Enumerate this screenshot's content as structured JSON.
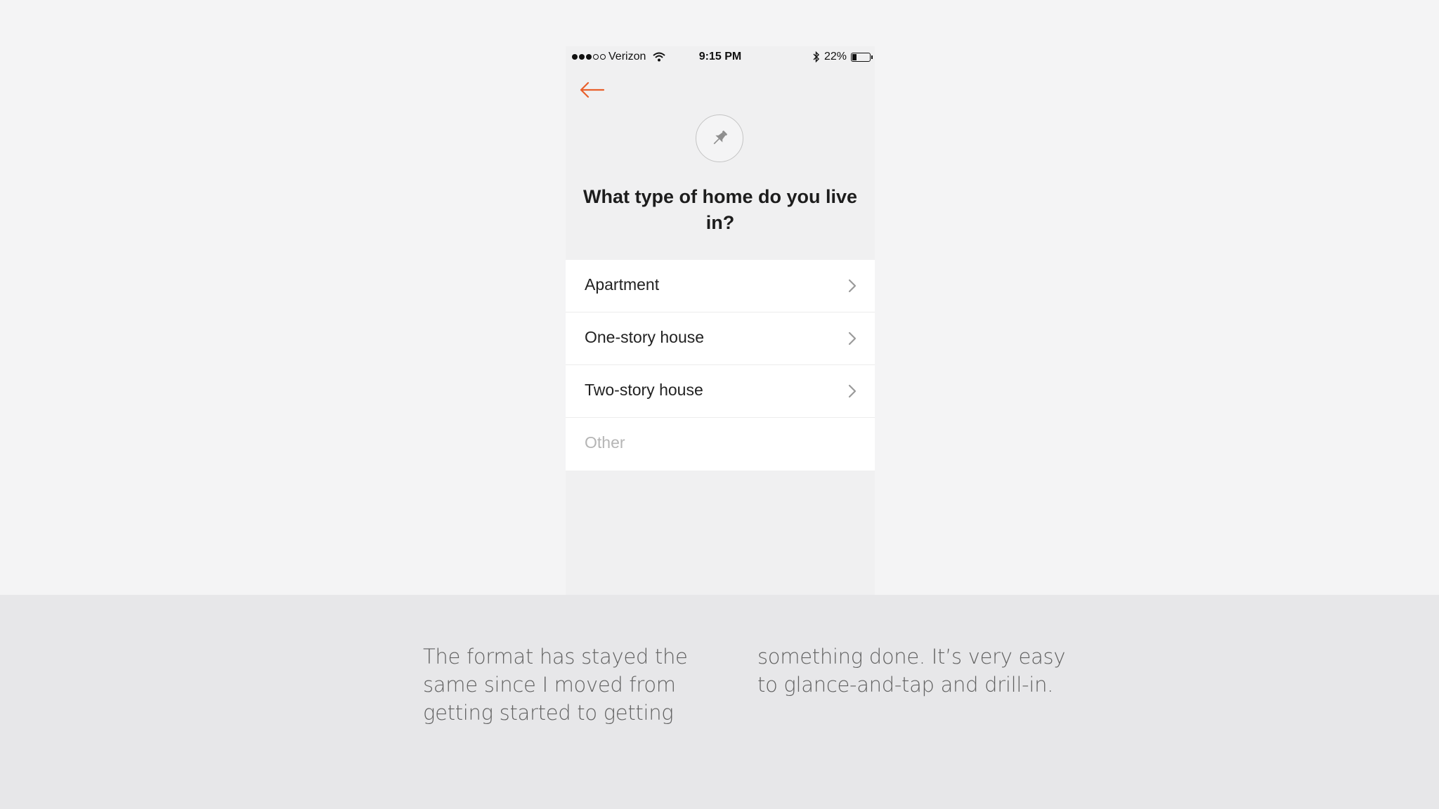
{
  "status_bar": {
    "carrier": "Verizon",
    "time": "9:15 PM",
    "battery_percent": "22%",
    "battery_level": 0.22,
    "signal_bars_filled": 3,
    "signal_bars_total": 5
  },
  "screen": {
    "back_icon": "arrow-left-icon",
    "header_icon": "pushpin-icon",
    "question": "What type of home do you live in?",
    "options": [
      {
        "label": "Apartment",
        "has_chevron": true
      },
      {
        "label": "One-story house",
        "has_chevron": true
      },
      {
        "label": "Two-story house",
        "has_chevron": true
      },
      {
        "label": "Other",
        "has_chevron": false
      }
    ]
  },
  "caption": {
    "left_text": "The format has stayed the same since I moved from getting started to getting",
    "right_text": "something done. It’s very easy to glance-and-tap and drill-in."
  },
  "colors": {
    "accent": "#e8602c",
    "background": "#f4f4f5",
    "caption_band": "#e7e7e9"
  }
}
